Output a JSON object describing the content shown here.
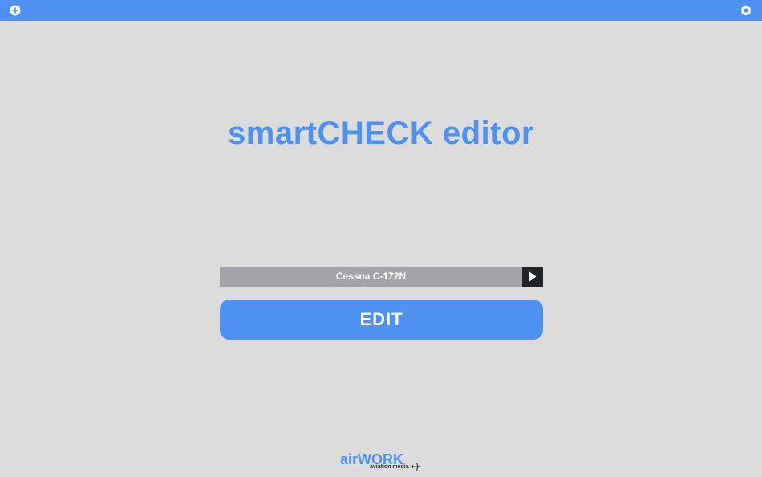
{
  "topbar": {
    "add_icon": "plus-circle-icon",
    "settings_icon": "gear-icon"
  },
  "title": "smartCHECK editor",
  "selector": {
    "value": "Cessna C-172N",
    "next_icon": "play-triangle-icon"
  },
  "edit_button": {
    "label": "EDIT"
  },
  "logo": {
    "brand": "airWORK",
    "tagline": "aviation media",
    "icon": "airplane-icon"
  },
  "colors": {
    "accent": "#4f91f0",
    "background": "#dcdcdc",
    "selector_bg": "#a4a3a9",
    "selector_button": "#222326"
  }
}
